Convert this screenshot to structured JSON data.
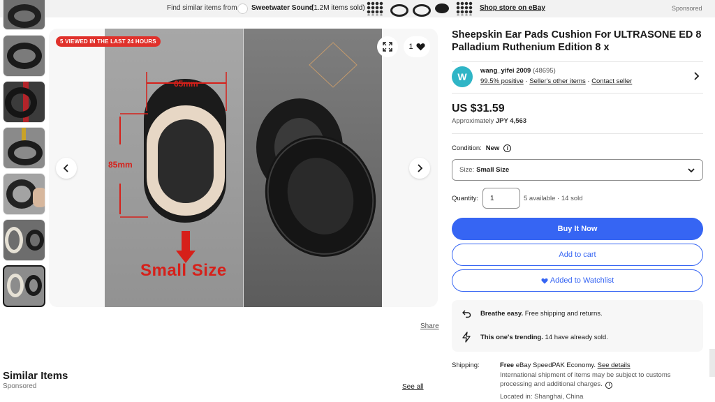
{
  "banner": {
    "find_text": "Find similar items from",
    "store_name": "Sweetwater Sound",
    "sold_text": "(1.2M items sold)",
    "shop_link": "Shop store on eBay",
    "sponsored": "Sponsored"
  },
  "gallery": {
    "viewed_badge": "5 VIEWED IN THE LAST 24 HOURS",
    "watch_count": "1",
    "image_labels": {
      "width": "65mm",
      "height": "85mm",
      "caption": "Small Size"
    },
    "share": "Share"
  },
  "similar": {
    "title": "Similar Items",
    "sponsored": "Sponsored",
    "see_all": "See all"
  },
  "listing": {
    "title": "Sheepskin Ear Pads Cushion For ULTRASONE ED 8 Palladium Ruthenium Edition 8 x",
    "seller": {
      "initial": "W",
      "name": "wang_yifei 2009",
      "score": "(48695)",
      "positive": "99.5% positive",
      "other_items": "Seller's other items",
      "contact": "Contact seller"
    },
    "price": "US $31.59",
    "approx_label": "Approximately",
    "approx_value": "JPY 4,563",
    "condition_label": "Condition:",
    "condition_value": "New",
    "size_label": "Size:",
    "size_value": "Small Size",
    "quantity_label": "Quantity:",
    "quantity_value": "1",
    "availability": "5 available · 14 sold",
    "buy_now": "Buy It Now",
    "add_to_cart": "Add to cart",
    "watchlist": "Added to Watchlist"
  },
  "perks": {
    "perk1_title": "Breathe easy.",
    "perk1_text": "Free shipping and returns.",
    "perk2_title": "This one's trending.",
    "perk2_text": "14 have already sold."
  },
  "shipping": {
    "label": "Shipping:",
    "free": "Free",
    "method": "eBay SpeedPAK Economy.",
    "details_link": "See details",
    "note": "International shipment of items may be subject to customs processing and additional charges.",
    "location": "Located in: Shanghai, China"
  },
  "colors": {
    "accent": "#3665f3",
    "badge_red": "#e0312b",
    "avatar": "#2fb5c6"
  },
  "icons": [
    "store-logo-icon",
    "expand-icon",
    "heart-icon",
    "chevron-left-icon",
    "chevron-right-icon",
    "info-icon",
    "chevron-down-icon",
    "return-arrow-icon",
    "lightning-icon"
  ]
}
